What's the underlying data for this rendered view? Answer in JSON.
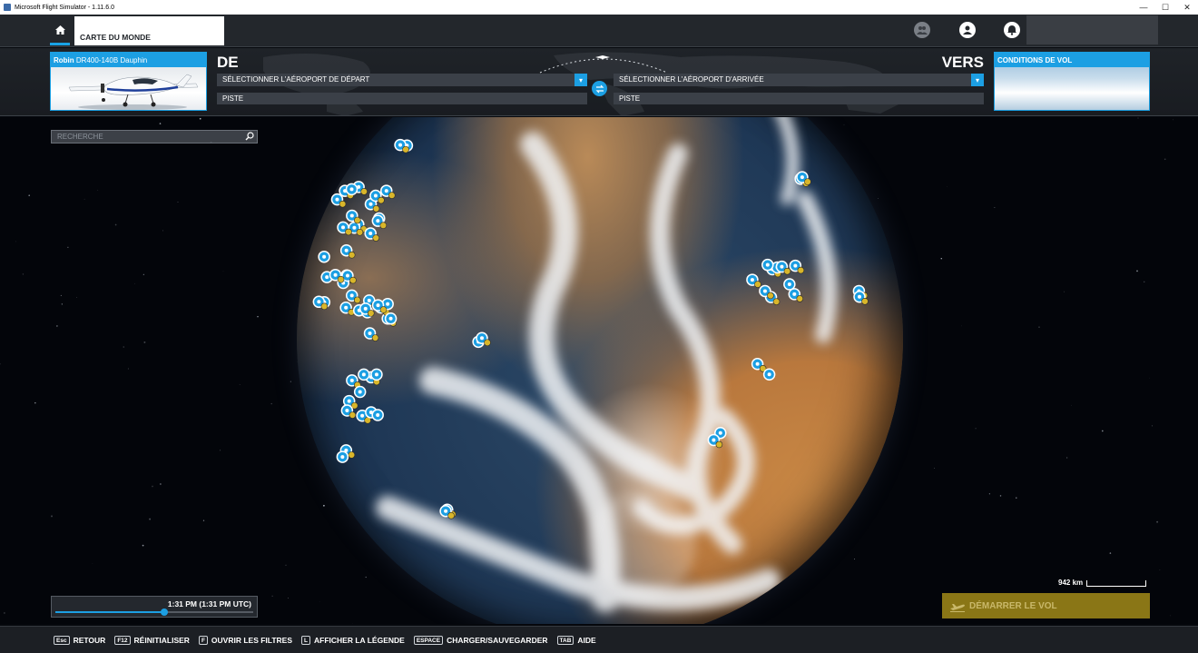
{
  "titlebar": {
    "title": "Microsoft Flight Simulator - 1.11.6.0",
    "minimize": "—",
    "maximize": "☐",
    "close": "✕"
  },
  "topnav": {
    "tab_world_map": "CARTE DU MONDE"
  },
  "aircraft": {
    "brand": "Robin",
    "model": "DR400-140B Dauphin"
  },
  "departure": {
    "label": "DE",
    "airport_placeholder": "SÉLECTIONNER L'AÉROPORT DE DÉPART",
    "runway": "PISTE"
  },
  "arrival": {
    "label": "VERS",
    "airport_placeholder": "SÉLECTIONNER L'AÉROPORT D'ARRIVÉE",
    "runway": "PISTE"
  },
  "weather": {
    "title": "CONDITIONS DE VOL"
  },
  "map": {
    "search_placeholder": "RECHERCHE",
    "time": "1:31 PM (1:31 PM UTC)",
    "time_progress": 0.55,
    "scale_label": "942 km"
  },
  "start_flight": {
    "label": "DÉMARRER LE VOL"
  },
  "bottombar": {
    "shortcuts": [
      {
        "key": "Esc",
        "label": "RETOUR"
      },
      {
        "key": "F12",
        "label": "RÉINITIALISER"
      },
      {
        "key": "F",
        "label": "OUVRIR LES FILTRES"
      },
      {
        "key": "L",
        "label": "AFFICHER LA LÉGENDE"
      },
      {
        "key": "ESPACE",
        "label": "CHARGER/SAUVEGARDER"
      },
      {
        "key": "TAB",
        "label": "AIDE"
      }
    ]
  },
  "colors": {
    "accent": "#1c9fe3",
    "start_button": "#8a7616",
    "nav_bg": "#23272c"
  },
  "icons": [
    "home-icon",
    "multiplayer-icon",
    "profile-icon",
    "notifications-icon",
    "swap-icon",
    "search-icon",
    "takeoff-icon",
    "airport-marker-icon"
  ]
}
